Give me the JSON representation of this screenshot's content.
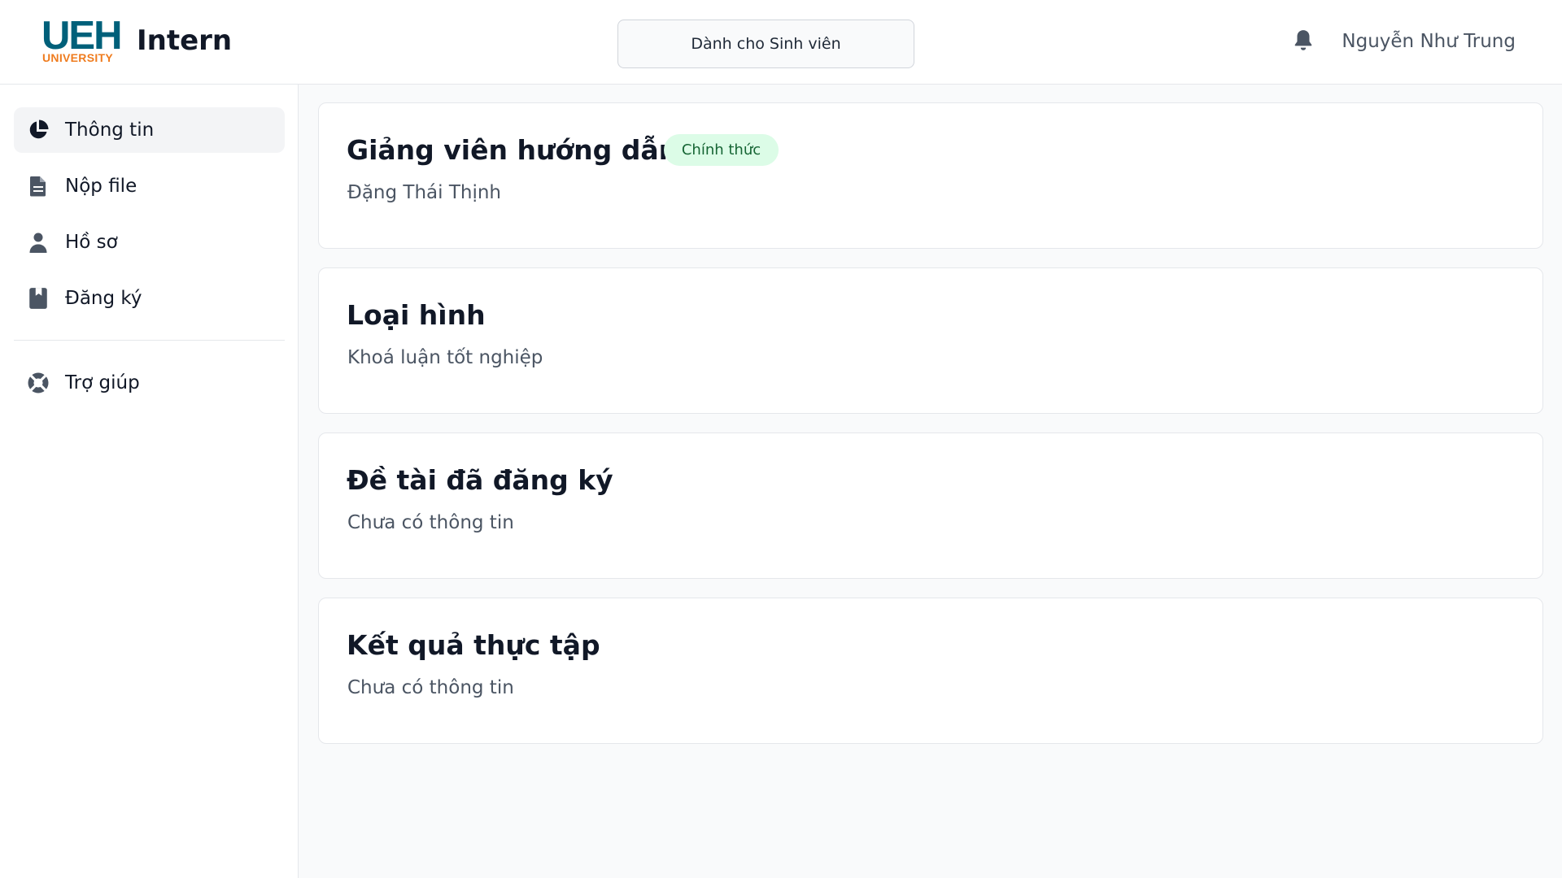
{
  "header": {
    "logo_main": "UEH",
    "logo_sub": "UNIVERSITY",
    "brand_name": "Intern",
    "role_button": "Dành cho Sinh viên",
    "user_name": "Nguyễn Như Trung",
    "notification_icon": "bell-icon"
  },
  "sidebar": {
    "items": [
      {
        "label": "Thông tin",
        "icon": "pie-chart-icon",
        "active": true
      },
      {
        "label": "Nộp file",
        "icon": "document-icon",
        "active": false
      },
      {
        "label": "Hồ sơ",
        "icon": "user-icon",
        "active": false
      },
      {
        "label": "Đăng ký",
        "icon": "bookmark-book-icon",
        "active": false
      }
    ],
    "help": {
      "label": "Trợ giúp",
      "icon": "lifebuoy-icon"
    }
  },
  "cards": [
    {
      "title": "Giảng viên hướng dẫn",
      "value": "Đặng Thái Thịnh",
      "badge": "Chính thức"
    },
    {
      "title": "Loại hình",
      "value": "Khoá luận tốt nghiệp"
    },
    {
      "title": "Đề tài đã đăng ký",
      "value": "Chưa có thông tin"
    },
    {
      "title": "Kết quả thực tập",
      "value": "Chưa có thông tin"
    }
  ],
  "colors": {
    "brand_teal": "#00607a",
    "brand_orange": "#ef7c1f",
    "badge_bg": "#dcfce7",
    "badge_text": "#166534",
    "icon_gray": "#4b5563"
  }
}
